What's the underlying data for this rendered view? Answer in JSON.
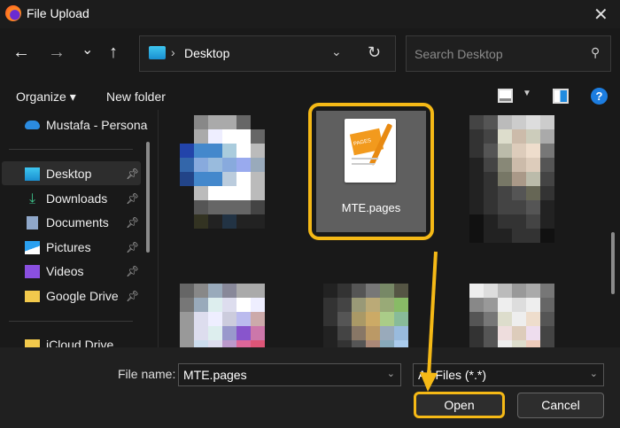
{
  "window": {
    "title": "File Upload",
    "close_icon": "close-icon"
  },
  "nav": {
    "back": "←",
    "forward": "→",
    "recent": "⌄",
    "up": "↑",
    "breadcrumb_sep": "›",
    "location": "Desktop",
    "refresh": "↻",
    "search_placeholder": "Search Desktop"
  },
  "toolbar": {
    "organize": "Organize ▾",
    "new_folder": "New folder",
    "help": "?"
  },
  "sidebar": {
    "items": [
      {
        "label": "Mustafa - Persona",
        "icon": "onedrive-icon"
      },
      {
        "label": "Desktop",
        "icon": "desktop-icon",
        "pinned": true,
        "selected": true
      },
      {
        "label": "Downloads",
        "icon": "download-icon",
        "pinned": true
      },
      {
        "label": "Documents",
        "icon": "document-icon",
        "pinned": true
      },
      {
        "label": "Pictures",
        "icon": "pictures-icon",
        "pinned": true
      },
      {
        "label": "Videos",
        "icon": "videos-icon",
        "pinned": true
      },
      {
        "label": "Google Drive",
        "icon": "folder-icon",
        "pinned": true
      },
      {
        "label": "iCloud Drive",
        "icon": "folder-icon"
      }
    ]
  },
  "files": {
    "selected_name": "MTE.pages",
    "doc_badge": "PAGES"
  },
  "footer": {
    "file_name_label": "File name:",
    "file_name_value": "MTE.pages",
    "file_type": "All Files (*.*)",
    "open": "Open",
    "cancel": "Cancel"
  },
  "colors": {
    "highlight": "#f5b916"
  }
}
